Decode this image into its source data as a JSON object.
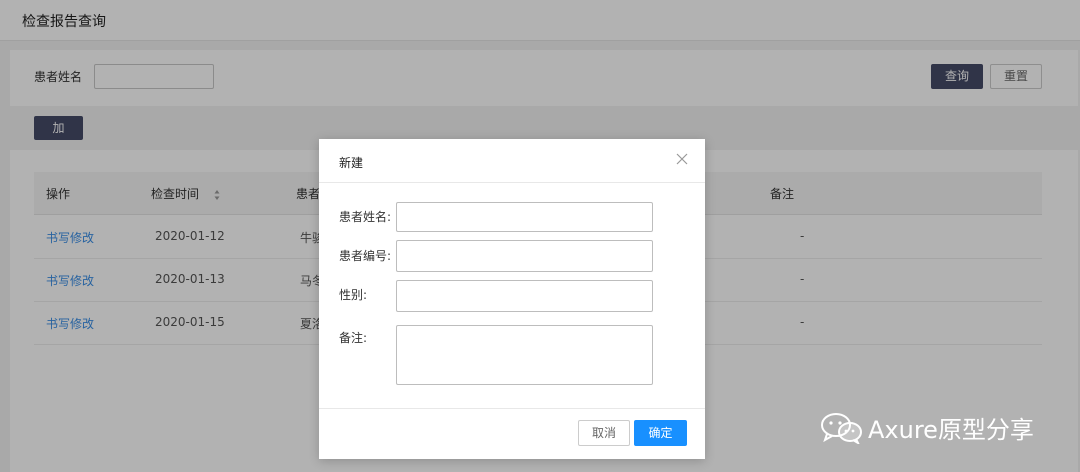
{
  "page_title": "检查报告查询",
  "search": {
    "name_label": "患者姓名",
    "name_value": "",
    "query_label": "查询",
    "reset_label": "重置"
  },
  "add_label": "加",
  "table": {
    "headers": [
      "操作",
      "检查时间",
      "患者",
      "备注"
    ],
    "rows": [
      {
        "action": "书写修改",
        "date": "2020-01-12",
        "patient": "牛骏",
        "note": "-"
      },
      {
        "action": "书写修改",
        "date": "2020-01-13",
        "patient": "马冬",
        "note": "-"
      },
      {
        "action": "书写修改",
        "date": "2020-01-15",
        "patient": "夏洛",
        "note": "-"
      }
    ]
  },
  "modal": {
    "title": "新建",
    "fields": [
      {
        "label": "患者姓名:",
        "value": ""
      },
      {
        "label": "患者编号:",
        "value": ""
      },
      {
        "label": "性别:",
        "value": ""
      },
      {
        "label": "备注:",
        "value": ""
      }
    ],
    "cancel_label": "取消",
    "confirm_label": "确定"
  },
  "watermark": "Axure原型分享",
  "colors": {
    "primary": "#1890ff",
    "dark_button": "#464b68",
    "link": "#3a8ee6"
  }
}
